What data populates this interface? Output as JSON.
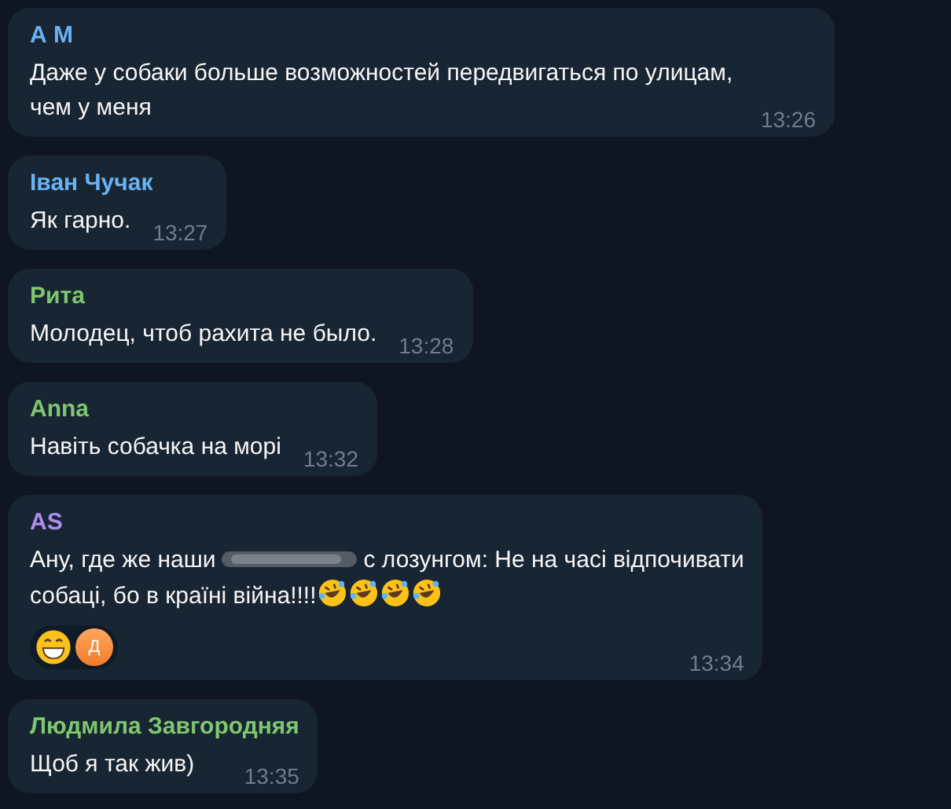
{
  "messages": [
    {
      "sender": "А М",
      "color": "#6ab3f3",
      "parts": [
        {
          "kind": "text",
          "text": "Даже у собаки больше возможностей передвигаться по улицам, чем у меня"
        }
      ],
      "time": "13:26"
    },
    {
      "sender": "Іван Чучак",
      "color": "#6ab3f3",
      "parts": [
        {
          "kind": "text",
          "text": "Як гарно."
        }
      ],
      "time": "13:27"
    },
    {
      "sender": "Рита",
      "color": "#7ec76f",
      "parts": [
        {
          "kind": "text",
          "text": "Молодец, чтоб рахита не было."
        }
      ],
      "time": "13:28"
    },
    {
      "sender": "Anna",
      "color": "#7ec76f",
      "parts": [
        {
          "kind": "text",
          "text": "Навіть собачка на морі"
        }
      ],
      "time": "13:32"
    },
    {
      "sender": "AS",
      "color": "#b18cf0",
      "parts": [
        {
          "kind": "text",
          "text": "Ану, где же наши"
        },
        {
          "kind": "hidden"
        },
        {
          "kind": "text",
          "text": "с лозунгом: Не на часі відпочивати"
        },
        {
          "kind": "break"
        },
        {
          "kind": "text",
          "text": "собаці, бо в країні війна!!!!"
        },
        {
          "kind": "emoji"
        },
        {
          "kind": "emoji"
        },
        {
          "kind": "emoji"
        },
        {
          "kind": "emoji"
        }
      ],
      "reactions": [
        {
          "kind": "emoji"
        },
        {
          "kind": "avatar",
          "letter": "Д"
        }
      ],
      "time": "13:34"
    },
    {
      "sender": "Людмила Завгородняя",
      "color": "#7ec76f",
      "parts": [
        {
          "kind": "text",
          "text": "Щоб я так жив)"
        }
      ],
      "time": "13:35"
    }
  ]
}
